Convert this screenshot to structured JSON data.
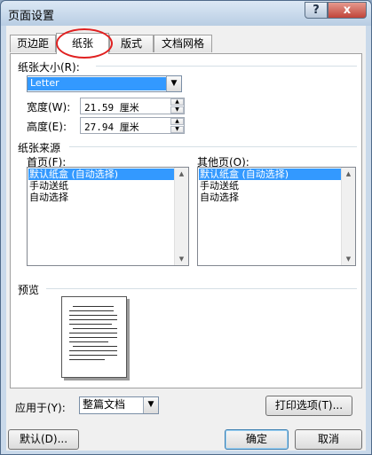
{
  "window": {
    "title": "页面设置",
    "help_label": "?",
    "close_label": "x"
  },
  "tabs": [
    {
      "label": "页边距"
    },
    {
      "label": "纸张"
    },
    {
      "label": "版式"
    },
    {
      "label": "文档网格"
    }
  ],
  "paper_size": {
    "label": "纸张大小(R):",
    "value": "Letter",
    "width_label": "宽度(W):",
    "width_value": "21.59 厘米",
    "height_label": "高度(E):",
    "height_value": "27.94 厘米"
  },
  "paper_source": {
    "label": "纸张来源",
    "first_page_label": "首页(F):",
    "other_pages_label": "其他页(O):",
    "items": [
      "默认纸盒 (自动选择)",
      "手动送纸",
      "自动选择"
    ],
    "selected_index": 0
  },
  "preview": {
    "label": "预览"
  },
  "apply": {
    "label": "应用于(Y):",
    "value": "整篇文档"
  },
  "buttons": {
    "print_options": "打印选项(T)...",
    "default": "默认(D)...",
    "ok": "确定",
    "cancel": "取消"
  },
  "colors": {
    "selection": "#3399ff",
    "highlight_circle": "#e02020"
  },
  "icons": {
    "dropdown": "chevron-down-icon",
    "spin_up": "triangle-up-icon",
    "spin_down": "triangle-down-icon"
  }
}
